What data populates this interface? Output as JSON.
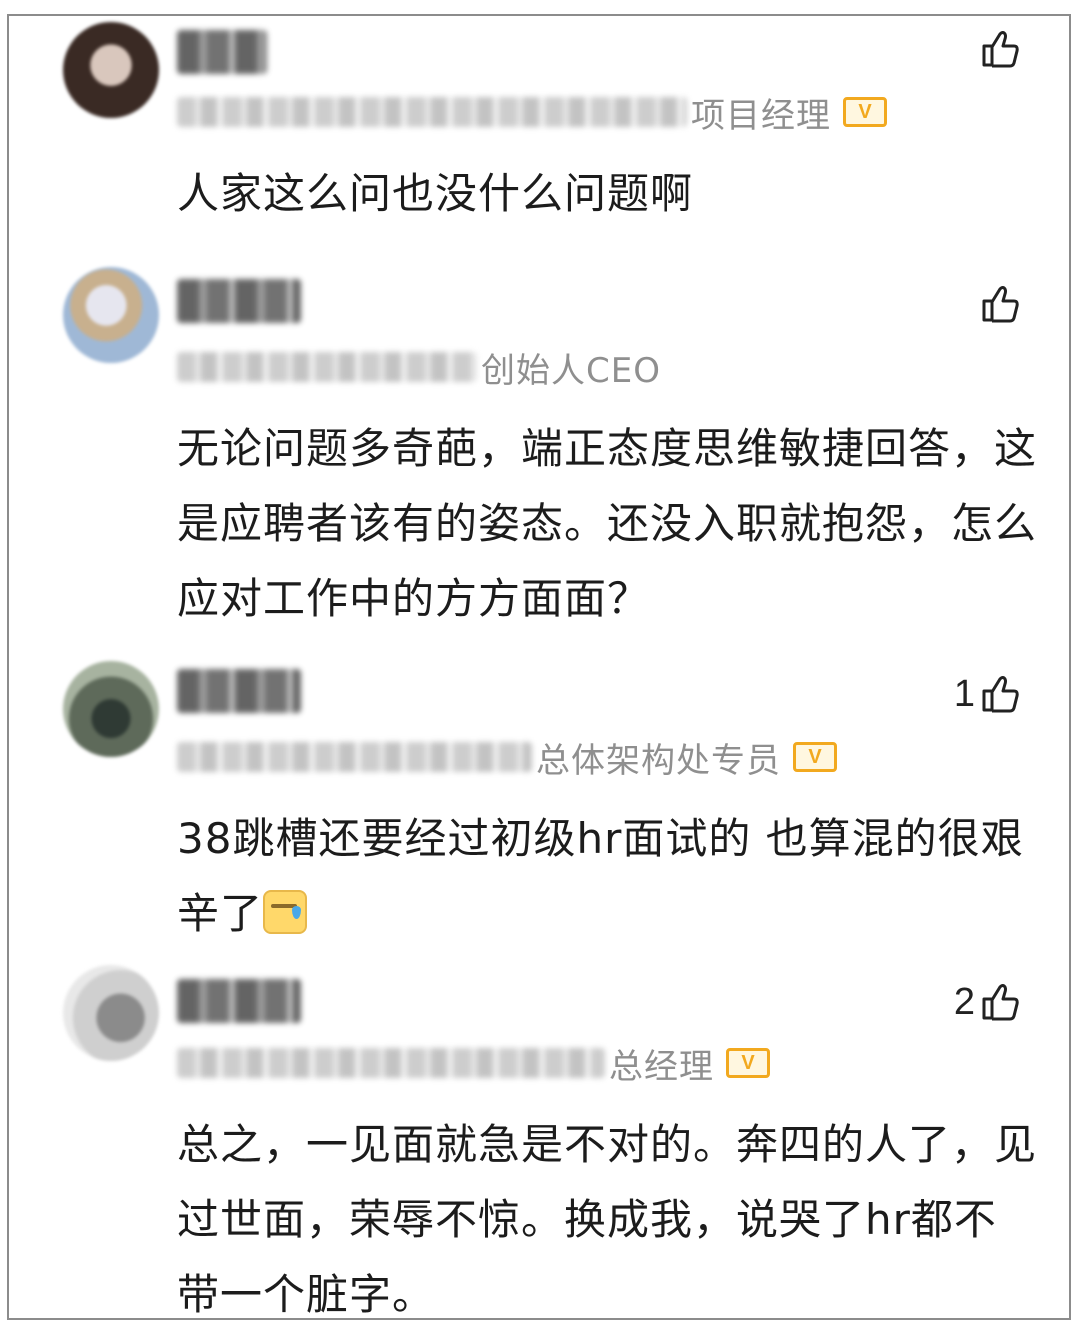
{
  "comments": [
    {
      "role": "项目经理",
      "verified": true,
      "likes": "",
      "text": "人家这么问也没什么问题啊",
      "avatar_colors": [
        "#3a2a24",
        "#d9c7bd",
        "#7a5a4e"
      ]
    },
    {
      "role": "创始人CEO",
      "verified": false,
      "likes": "",
      "text": "无论问题多奇葩，端正态度思维敏捷回答，这是应聘者该有的姿态。还没入职就抱怨，怎么应对工作中的方方面面？",
      "avatar_colors": [
        "#9fb8d6",
        "#e6e6ef",
        "#c8b08e"
      ]
    },
    {
      "role": "总体架构处专员",
      "verified": true,
      "likes": "1",
      "text": "38跳槽还要经过初级hr面试的  也算混的很艰辛了",
      "avatar_colors": [
        "#5e6a5a",
        "#a7b3a0",
        "#2f3a34"
      ]
    },
    {
      "role": "总经理",
      "verified": true,
      "likes": "2",
      "text": "总之，一见面就急是不对的。奔四的人了，见过世面，荣辱不惊。换成我，说哭了hr都不带一个脏字。",
      "avatar_colors": [
        "#cfcfcf",
        "#8b8b8b",
        "#e8e8e8"
      ]
    }
  ],
  "badge_label": "V",
  "icons": {
    "like": "thumbs-up-icon",
    "verified": "verified-v-badge-icon"
  }
}
